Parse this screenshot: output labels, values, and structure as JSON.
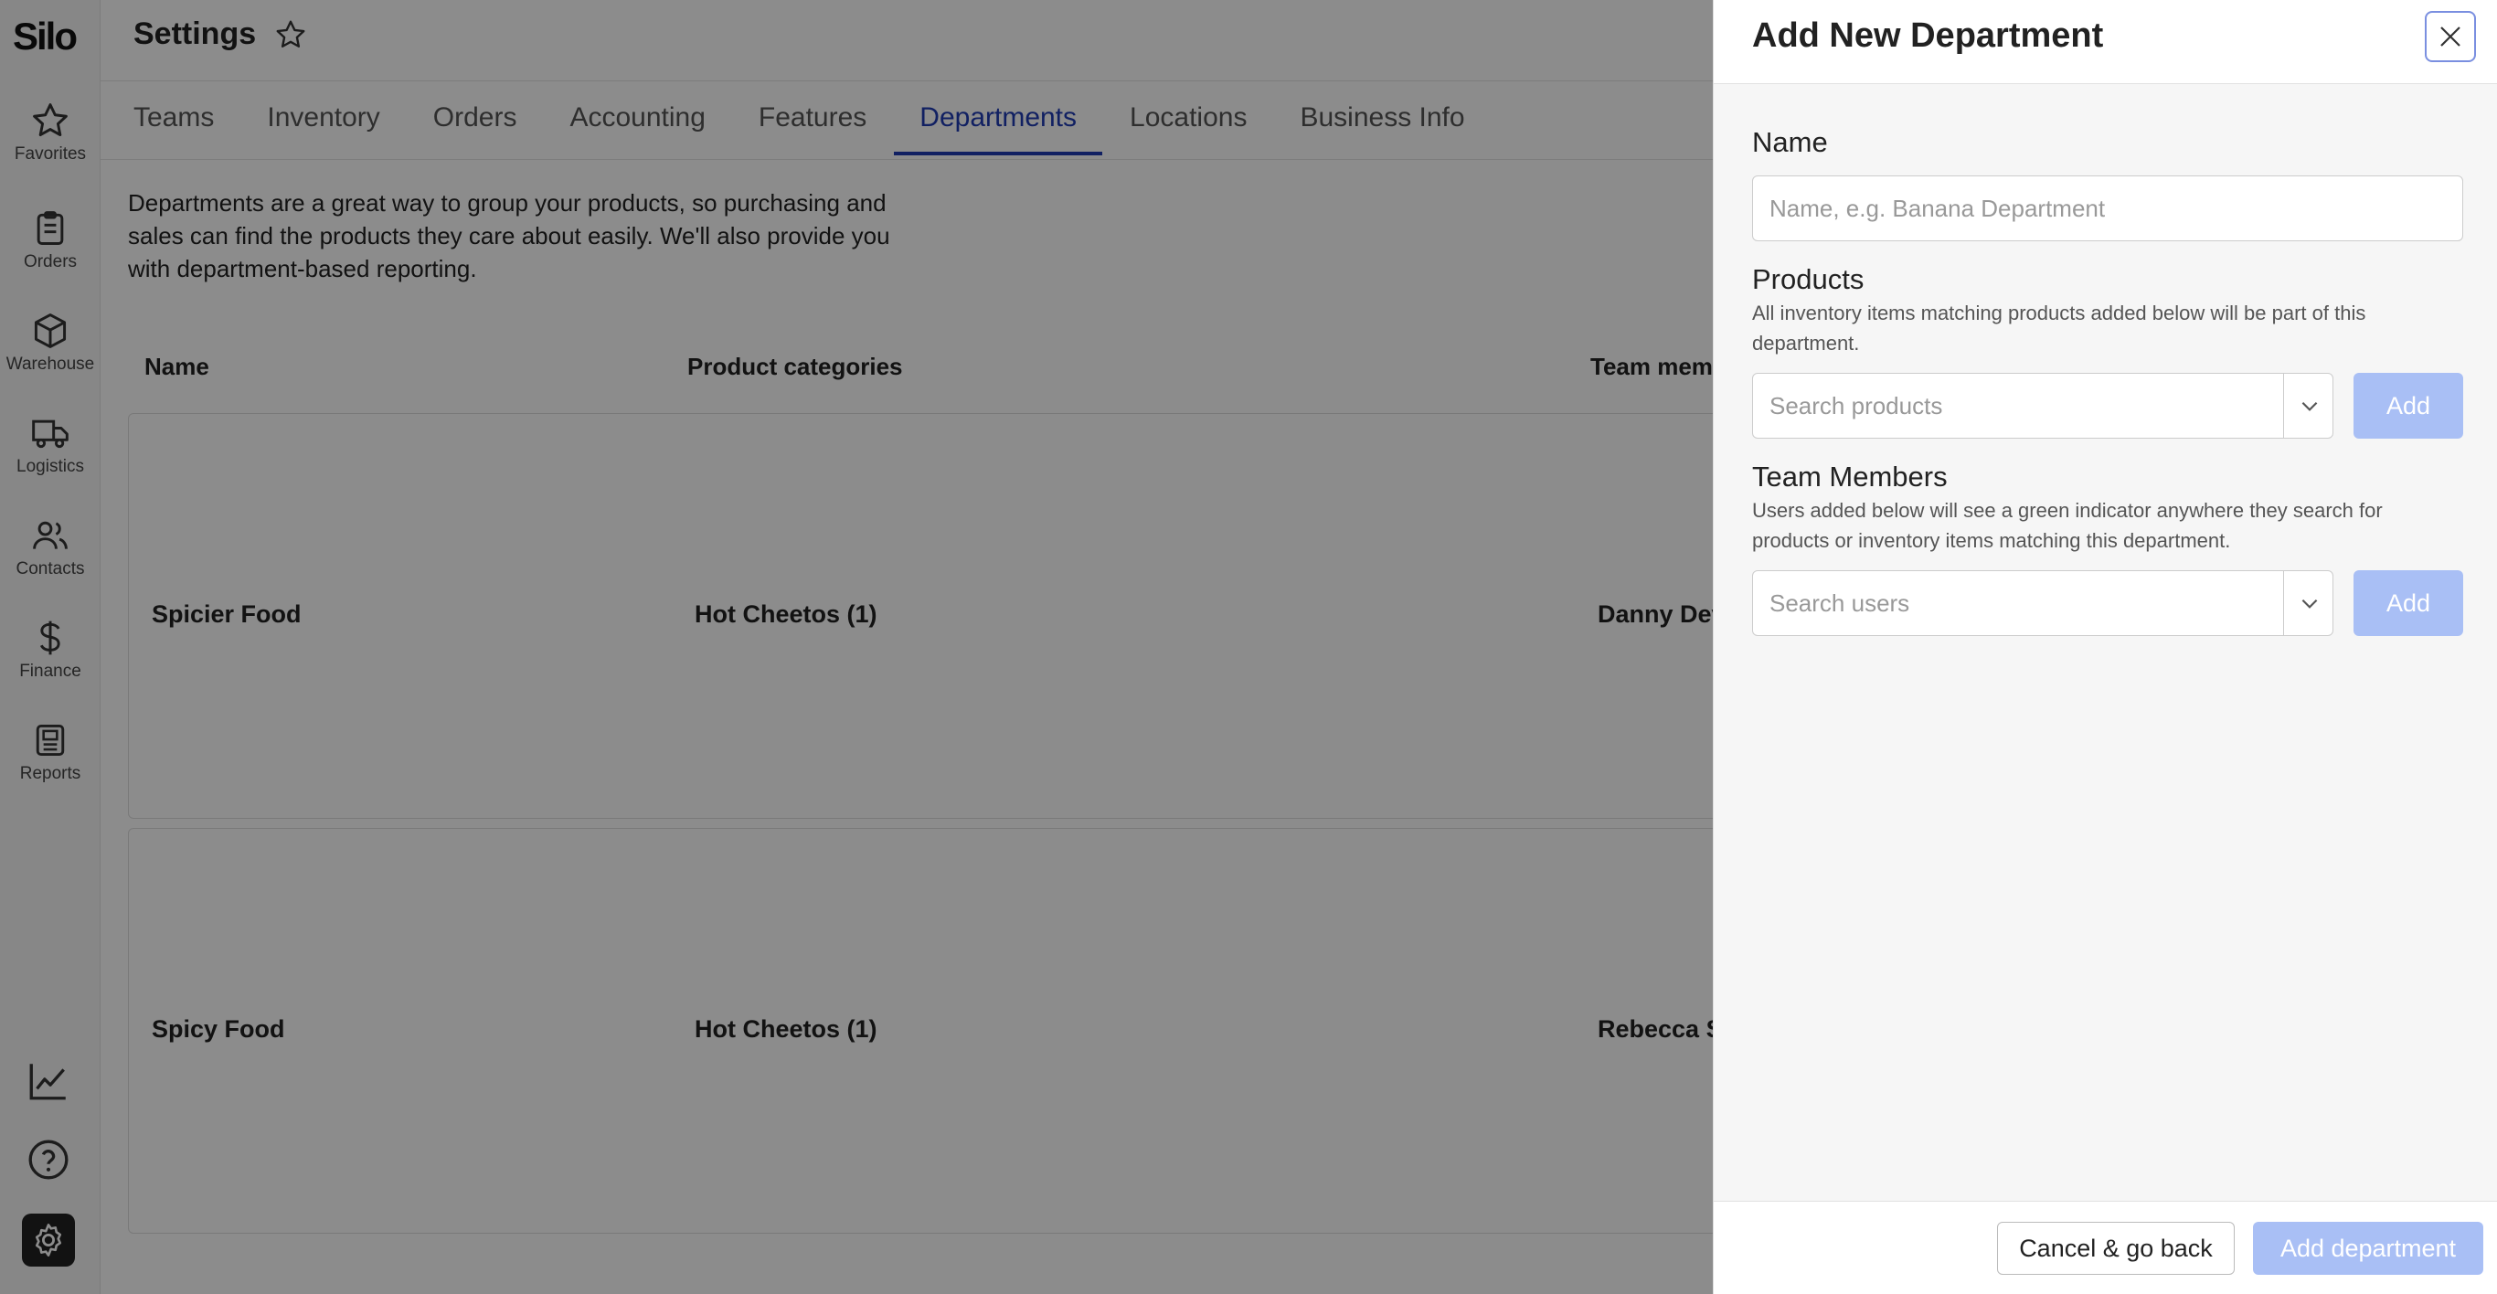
{
  "sidebar": {
    "logo": "Silo",
    "items": [
      {
        "label": "Favorites",
        "icon": "star-icon"
      },
      {
        "label": "Orders",
        "icon": "clipboard-icon"
      },
      {
        "label": "Warehouse",
        "icon": "box-icon"
      },
      {
        "label": "Logistics",
        "icon": "truck-icon"
      },
      {
        "label": "Contacts",
        "icon": "users-icon"
      },
      {
        "label": "Finance",
        "icon": "dollar-icon"
      },
      {
        "label": "Reports",
        "icon": "report-icon"
      }
    ],
    "bottom_icons": [
      "trend-chart-icon",
      "help-icon",
      "gear-icon"
    ]
  },
  "header": {
    "title": "Settings"
  },
  "tabs": [
    {
      "label": "Teams",
      "active": false
    },
    {
      "label": "Inventory",
      "active": false
    },
    {
      "label": "Orders",
      "active": false
    },
    {
      "label": "Accounting",
      "active": false
    },
    {
      "label": "Features",
      "active": false
    },
    {
      "label": "Departments",
      "active": true
    },
    {
      "label": "Locations",
      "active": false
    },
    {
      "label": "Business Info",
      "active": false
    }
  ],
  "intro": {
    "line1": "Departments are a great way to group your products, so purchasing and",
    "line2": "sales can find the products they care about easily. We'll also provide you",
    "line3": "with department-based reporting."
  },
  "table": {
    "columns": [
      "Name",
      "Product categories",
      "Team mem"
    ],
    "rows": [
      {
        "name": "Spicier Food",
        "categories": "Hot Cheetos (1)",
        "team": "Danny Dev"
      },
      {
        "name": "Spicy Food",
        "categories": "Hot Cheetos (1)",
        "team": "Rebecca S"
      }
    ]
  },
  "drawer": {
    "title": "Add New Department",
    "name_label": "Name",
    "name_placeholder": "Name, e.g. Banana Department",
    "products_label": "Products",
    "products_help_1": "All inventory items matching products added below will be part of this",
    "products_help_2": "department.",
    "products_placeholder": "Search products",
    "products_add": "Add",
    "team_label": "Team Members",
    "team_help_1": "Users added below will see a green indicator anywhere they search for",
    "team_help_2": "products or inventory items matching this department.",
    "team_placeholder": "Search users",
    "team_add": "Add",
    "cancel_label": "Cancel & go back",
    "submit_label": "Add department"
  },
  "colors": {
    "accent": "#1f3bb3",
    "disabled_button": "#a9bff5",
    "overlay": "rgba(0,0,0,0.45)"
  }
}
